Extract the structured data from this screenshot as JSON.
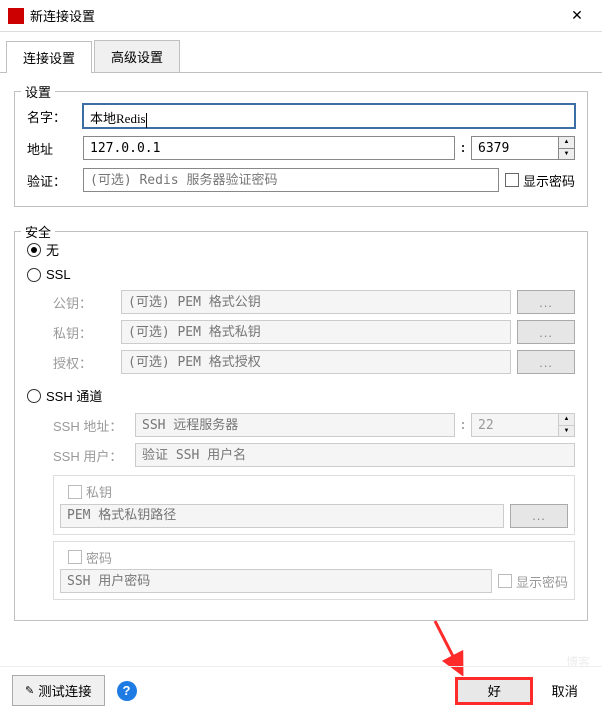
{
  "titlebar": {
    "title": "新连接设置",
    "close": "✕"
  },
  "tabs": {
    "connection": "连接设置",
    "advanced": "高级设置"
  },
  "settings": {
    "legend": "设置",
    "name_label": "名字：",
    "name_value": "本地Redis",
    "addr_label": "地址",
    "addr_value": "127.0.0.1",
    "port_sep": ":",
    "port_value": "6379",
    "auth_label": "验证：",
    "auth_placeholder": "(可选) Redis 服务器验证密码",
    "show_pwd_label": "显示密码"
  },
  "security": {
    "legend": "安全",
    "none": "无",
    "ssl": "SSL",
    "pubkey_label": "公钥：",
    "pubkey_placeholder": "(可选) PEM 格式公钥",
    "privkey_label": "私钥：",
    "privkey_placeholder": "(可选) PEM 格式私钥",
    "ca_label": "授权：",
    "ca_placeholder": "(可选) PEM 格式授权",
    "browse": "...",
    "ssh": "SSH 通道",
    "ssh_addr_label": "SSH 地址：",
    "ssh_addr_placeholder": "SSH 远程服务器",
    "ssh_port_sep": ":",
    "ssh_port_value": "22",
    "ssh_user_label": "SSH 用户：",
    "ssh_user_placeholder": "验证 SSH 用户名",
    "ssh_pk_label": "私钥",
    "ssh_pk_placeholder": "PEM 格式私钥路径",
    "ssh_pwd_label": "密码",
    "ssh_pwd_placeholder": "SSH 用户密码",
    "ssh_show_pwd": "显示密码"
  },
  "footer": {
    "test": "测试连接",
    "help": "?",
    "ok": "好",
    "cancel": "取消"
  },
  "watermark": "博客"
}
